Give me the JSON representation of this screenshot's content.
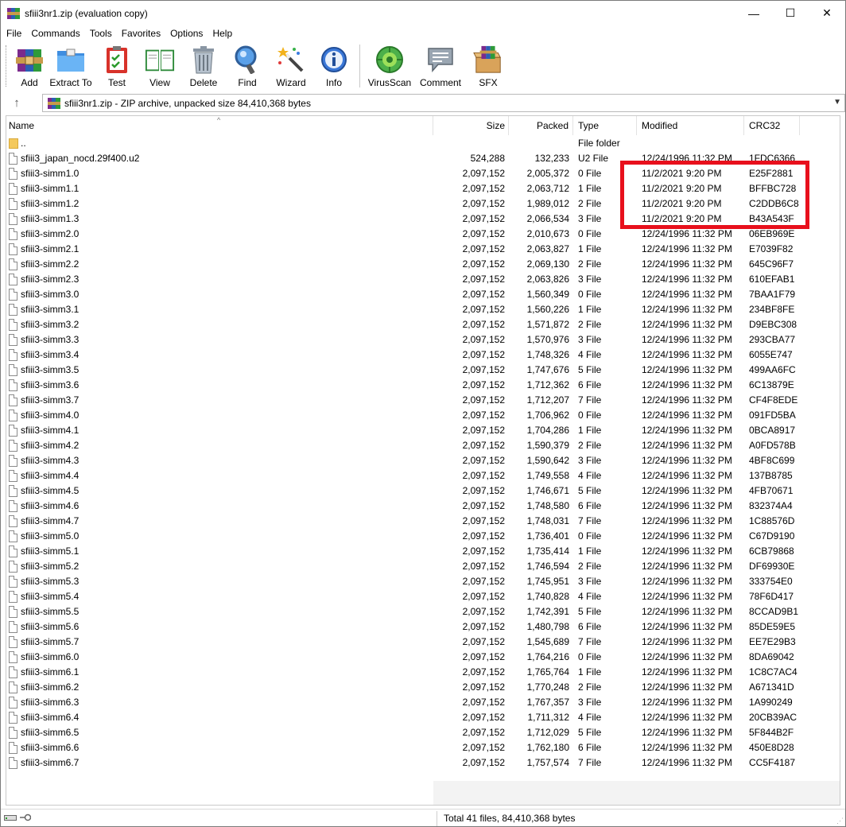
{
  "window": {
    "title": "sfiii3nr1.zip (evaluation copy)",
    "minimize": "—",
    "maximize": "☐",
    "close": "✕"
  },
  "menu": [
    "File",
    "Commands",
    "Tools",
    "Favorites",
    "Options",
    "Help"
  ],
  "toolbar": [
    {
      "label": "Add",
      "icon": "winrar-add-icon"
    },
    {
      "label": "Extract To",
      "icon": "extract-folder-icon"
    },
    {
      "label": "Test",
      "icon": "test-clipboard-icon"
    },
    {
      "label": "View",
      "icon": "view-book-icon"
    },
    {
      "label": "Delete",
      "icon": "trash-icon"
    },
    {
      "label": "Find",
      "icon": "magnifier-icon"
    },
    {
      "label": "Wizard",
      "icon": "wand-icon"
    },
    {
      "label": "Info",
      "icon": "info-icon"
    },
    {
      "label": "VirusScan",
      "icon": "virus-scan-icon"
    },
    {
      "label": "Comment",
      "icon": "comment-icon"
    },
    {
      "label": "SFX",
      "icon": "sfx-box-icon"
    }
  ],
  "address": {
    "text": "sfiii3nr1.zip - ZIP archive, unpacked size 84,410,368 bytes"
  },
  "columns": {
    "name": "Name",
    "size": "Size",
    "packed": "Packed",
    "type": "Type",
    "modified": "Modified",
    "crc": "CRC32"
  },
  "files": [
    {
      "name": "..",
      "size": "",
      "packed": "",
      "type": "File folder",
      "modified": "",
      "crc": "",
      "folder": true
    },
    {
      "name": "sfiii3_japan_nocd.29f400.u2",
      "size": "524,288",
      "packed": "132,233",
      "type": "U2 File",
      "modified": "12/24/1996 11:32 PM",
      "crc": "1FDC6366"
    },
    {
      "name": "sfiii3-simm1.0",
      "size": "2,097,152",
      "packed": "2,005,372",
      "type": "0 File",
      "modified": "11/2/2021 9:20 PM",
      "crc": "E25F2881"
    },
    {
      "name": "sfiii3-simm1.1",
      "size": "2,097,152",
      "packed": "2,063,712",
      "type": "1 File",
      "modified": "11/2/2021 9:20 PM",
      "crc": "BFFBC728"
    },
    {
      "name": "sfiii3-simm1.2",
      "size": "2,097,152",
      "packed": "1,989,012",
      "type": "2 File",
      "modified": "11/2/2021 9:20 PM",
      "crc": "C2DDB6C8"
    },
    {
      "name": "sfiii3-simm1.3",
      "size": "2,097,152",
      "packed": "2,066,534",
      "type": "3 File",
      "modified": "11/2/2021 9:20 PM",
      "crc": "B43A543F"
    },
    {
      "name": "sfiii3-simm2.0",
      "size": "2,097,152",
      "packed": "2,010,673",
      "type": "0 File",
      "modified": "12/24/1996 11:32 PM",
      "crc": "06EB969E"
    },
    {
      "name": "sfiii3-simm2.1",
      "size": "2,097,152",
      "packed": "2,063,827",
      "type": "1 File",
      "modified": "12/24/1996 11:32 PM",
      "crc": "E7039F82"
    },
    {
      "name": "sfiii3-simm2.2",
      "size": "2,097,152",
      "packed": "2,069,130",
      "type": "2 File",
      "modified": "12/24/1996 11:32 PM",
      "crc": "645C96F7"
    },
    {
      "name": "sfiii3-simm2.3",
      "size": "2,097,152",
      "packed": "2,063,826",
      "type": "3 File",
      "modified": "12/24/1996 11:32 PM",
      "crc": "610EFAB1"
    },
    {
      "name": "sfiii3-simm3.0",
      "size": "2,097,152",
      "packed": "1,560,349",
      "type": "0 File",
      "modified": "12/24/1996 11:32 PM",
      "crc": "7BAA1F79"
    },
    {
      "name": "sfiii3-simm3.1",
      "size": "2,097,152",
      "packed": "1,560,226",
      "type": "1 File",
      "modified": "12/24/1996 11:32 PM",
      "crc": "234BF8FE"
    },
    {
      "name": "sfiii3-simm3.2",
      "size": "2,097,152",
      "packed": "1,571,872",
      "type": "2 File",
      "modified": "12/24/1996 11:32 PM",
      "crc": "D9EBC308"
    },
    {
      "name": "sfiii3-simm3.3",
      "size": "2,097,152",
      "packed": "1,570,976",
      "type": "3 File",
      "modified": "12/24/1996 11:32 PM",
      "crc": "293CBA77"
    },
    {
      "name": "sfiii3-simm3.4",
      "size": "2,097,152",
      "packed": "1,748,326",
      "type": "4 File",
      "modified": "12/24/1996 11:32 PM",
      "crc": "6055E747"
    },
    {
      "name": "sfiii3-simm3.5",
      "size": "2,097,152",
      "packed": "1,747,676",
      "type": "5 File",
      "modified": "12/24/1996 11:32 PM",
      "crc": "499AA6FC"
    },
    {
      "name": "sfiii3-simm3.6",
      "size": "2,097,152",
      "packed": "1,712,362",
      "type": "6 File",
      "modified": "12/24/1996 11:32 PM",
      "crc": "6C13879E"
    },
    {
      "name": "sfiii3-simm3.7",
      "size": "2,097,152",
      "packed": "1,712,207",
      "type": "7 File",
      "modified": "12/24/1996 11:32 PM",
      "crc": "CF4F8EDE"
    },
    {
      "name": "sfiii3-simm4.0",
      "size": "2,097,152",
      "packed": "1,706,962",
      "type": "0 File",
      "modified": "12/24/1996 11:32 PM",
      "crc": "091FD5BA"
    },
    {
      "name": "sfiii3-simm4.1",
      "size": "2,097,152",
      "packed": "1,704,286",
      "type": "1 File",
      "modified": "12/24/1996 11:32 PM",
      "crc": "0BCA8917"
    },
    {
      "name": "sfiii3-simm4.2",
      "size": "2,097,152",
      "packed": "1,590,379",
      "type": "2 File",
      "modified": "12/24/1996 11:32 PM",
      "crc": "A0FD578B"
    },
    {
      "name": "sfiii3-simm4.3",
      "size": "2,097,152",
      "packed": "1,590,642",
      "type": "3 File",
      "modified": "12/24/1996 11:32 PM",
      "crc": "4BF8C699"
    },
    {
      "name": "sfiii3-simm4.4",
      "size": "2,097,152",
      "packed": "1,749,558",
      "type": "4 File",
      "modified": "12/24/1996 11:32 PM",
      "crc": "137B8785"
    },
    {
      "name": "sfiii3-simm4.5",
      "size": "2,097,152",
      "packed": "1,746,671",
      "type": "5 File",
      "modified": "12/24/1996 11:32 PM",
      "crc": "4FB70671"
    },
    {
      "name": "sfiii3-simm4.6",
      "size": "2,097,152",
      "packed": "1,748,580",
      "type": "6 File",
      "modified": "12/24/1996 11:32 PM",
      "crc": "832374A4"
    },
    {
      "name": "sfiii3-simm4.7",
      "size": "2,097,152",
      "packed": "1,748,031",
      "type": "7 File",
      "modified": "12/24/1996 11:32 PM",
      "crc": "1C88576D"
    },
    {
      "name": "sfiii3-simm5.0",
      "size": "2,097,152",
      "packed": "1,736,401",
      "type": "0 File",
      "modified": "12/24/1996 11:32 PM",
      "crc": "C67D9190"
    },
    {
      "name": "sfiii3-simm5.1",
      "size": "2,097,152",
      "packed": "1,735,414",
      "type": "1 File",
      "modified": "12/24/1996 11:32 PM",
      "crc": "6CB79868"
    },
    {
      "name": "sfiii3-simm5.2",
      "size": "2,097,152",
      "packed": "1,746,594",
      "type": "2 File",
      "modified": "12/24/1996 11:32 PM",
      "crc": "DF69930E"
    },
    {
      "name": "sfiii3-simm5.3",
      "size": "2,097,152",
      "packed": "1,745,951",
      "type": "3 File",
      "modified": "12/24/1996 11:32 PM",
      "crc": "333754E0"
    },
    {
      "name": "sfiii3-simm5.4",
      "size": "2,097,152",
      "packed": "1,740,828",
      "type": "4 File",
      "modified": "12/24/1996 11:32 PM",
      "crc": "78F6D417"
    },
    {
      "name": "sfiii3-simm5.5",
      "size": "2,097,152",
      "packed": "1,742,391",
      "type": "5 File",
      "modified": "12/24/1996 11:32 PM",
      "crc": "8CCAD9B1"
    },
    {
      "name": "sfiii3-simm5.6",
      "size": "2,097,152",
      "packed": "1,480,798",
      "type": "6 File",
      "modified": "12/24/1996 11:32 PM",
      "crc": "85DE59E5"
    },
    {
      "name": "sfiii3-simm5.7",
      "size": "2,097,152",
      "packed": "1,545,689",
      "type": "7 File",
      "modified": "12/24/1996 11:32 PM",
      "crc": "EE7E29B3"
    },
    {
      "name": "sfiii3-simm6.0",
      "size": "2,097,152",
      "packed": "1,764,216",
      "type": "0 File",
      "modified": "12/24/1996 11:32 PM",
      "crc": "8DA69042"
    },
    {
      "name": "sfiii3-simm6.1",
      "size": "2,097,152",
      "packed": "1,765,764",
      "type": "1 File",
      "modified": "12/24/1996 11:32 PM",
      "crc": "1C8C7AC4"
    },
    {
      "name": "sfiii3-simm6.2",
      "size": "2,097,152",
      "packed": "1,770,248",
      "type": "2 File",
      "modified": "12/24/1996 11:32 PM",
      "crc": "A671341D"
    },
    {
      "name": "sfiii3-simm6.3",
      "size": "2,097,152",
      "packed": "1,767,357",
      "type": "3 File",
      "modified": "12/24/1996 11:32 PM",
      "crc": "1A990249"
    },
    {
      "name": "sfiii3-simm6.4",
      "size": "2,097,152",
      "packed": "1,711,312",
      "type": "4 File",
      "modified": "12/24/1996 11:32 PM",
      "crc": "20CB39AC"
    },
    {
      "name": "sfiii3-simm6.5",
      "size": "2,097,152",
      "packed": "1,712,029",
      "type": "5 File",
      "modified": "12/24/1996 11:32 PM",
      "crc": "5F844B2F"
    },
    {
      "name": "sfiii3-simm6.6",
      "size": "2,097,152",
      "packed": "1,762,180",
      "type": "6 File",
      "modified": "12/24/1996 11:32 PM",
      "crc": "450E8D28"
    },
    {
      "name": "sfiii3-simm6.7",
      "size": "2,097,152",
      "packed": "1,757,574",
      "type": "7 File",
      "modified": "12/24/1996 11:32 PM",
      "crc": "CC5F4187"
    }
  ],
  "status": {
    "text": "Total 41 files, 84,410,368 bytes"
  },
  "colors": {
    "highlight": "#e8101c"
  }
}
